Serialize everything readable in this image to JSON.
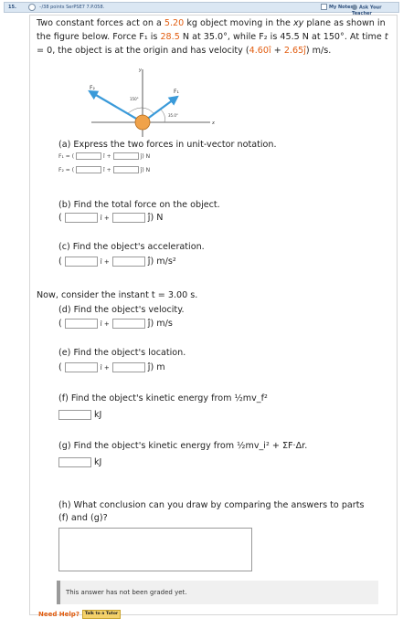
{
  "header": {
    "question_number": "15.",
    "points": "–/38 points",
    "assignment_code": "SerPSE7 7.P.058.",
    "my_notes": "My Notes",
    "ask_teacher": "Ask Your Teacher"
  },
  "problem": {
    "p1": "Two constant forces act on a ",
    "mass": "5.20",
    "p2": " kg object moving in the ",
    "xy": "xy",
    "p3": " plane as shown in the figure below. Force ",
    "f1_sym": "F₁",
    "p4": " is ",
    "f1_mag": "28.5",
    "p5": " N at 35.0°, while ",
    "f2_sym": "F₂",
    "p6": " is 45.5 N at 150°. At time ",
    "t_sym": "t",
    "p7": " = 0, the object is at the origin and has velocity (",
    "vx": "4.60î",
    "p8": " + ",
    "vy": "2.65ĵ",
    "p9": ") m/s."
  },
  "figure": {
    "label_f2": "F₂",
    "label_f1": "F₁",
    "angle_150": "150°",
    "angle_35": "35.0°",
    "axis_x": "x",
    "axis_y": "y"
  },
  "part_a": {
    "prompt": "(a) Express the two forces in unit-vector notation.",
    "f1_label": "F₁ =  (",
    "f2_label": "F₂ =  (",
    "i_plus": "î +",
    "j_unit": "ĵ) N"
  },
  "part_b": {
    "prompt": "(b) Find the total force on the object.",
    "open": "(",
    "i_plus": "î +",
    "unit": "ĵ) N"
  },
  "part_c": {
    "prompt": "(c) Find the object's acceleration.",
    "open": "(",
    "i_plus": "î +",
    "unit": "ĵ) m/s²"
  },
  "now_text": "Now, consider the instant t = 3.00 s.",
  "part_d": {
    "prompt": "(d) Find the object's velocity.",
    "open": "(",
    "i_plus": "î +",
    "unit": "ĵ) m/s"
  },
  "part_e": {
    "prompt": "(e) Find the object's location.",
    "open": "(",
    "i_plus": "î +",
    "unit": "ĵ) m"
  },
  "part_f": {
    "prompt": "(f) Find the object's kinetic energy from ½mv_f²",
    "unit": "kJ"
  },
  "part_g": {
    "prompt": "(g) Find the object's kinetic energy from ½mv_i² + ΣF·Δr.",
    "unit": "kJ"
  },
  "part_h": {
    "prompt_line1": "(h) What conclusion can you draw by comparing the answers to parts",
    "prompt_line2": "(f) and (g)?"
  },
  "not_graded": "This answer has not been graded yet.",
  "need_help": "Need Help?",
  "tutor_button": "Talk to a Tutor"
}
